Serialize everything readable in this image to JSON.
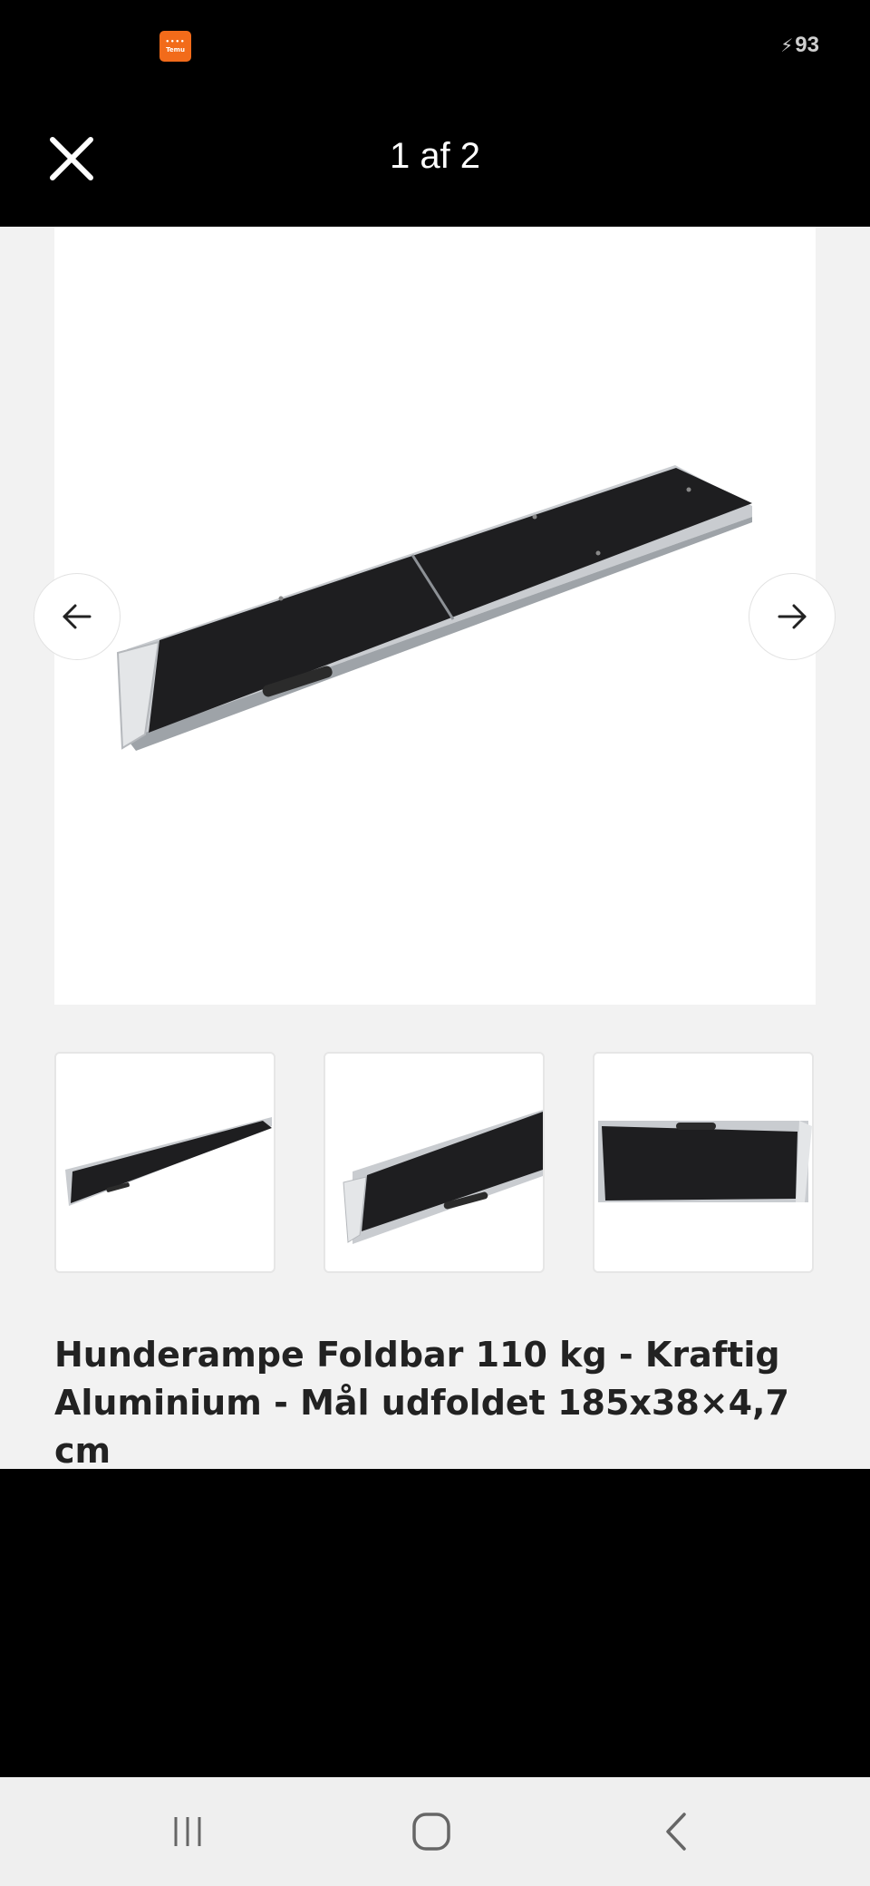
{
  "status_bar": {
    "app_icon_text": "Temu",
    "battery": "93"
  },
  "header": {
    "page_counter": "1 af 2"
  },
  "gallery": {
    "main_image": "folding-dog-ramp-photo",
    "thumbnails": [
      "ramp-unfolded-thumbnail",
      "ramp-closeup-thumbnail",
      "ramp-folded-thumbnail"
    ]
  },
  "product": {
    "title": "Hunderampe Foldbar 110 kg - Kraftig Aluminium - Mål udfoldet 185x38×4,7 cm"
  },
  "icons": {
    "close": "close-icon",
    "prev": "arrow-left-icon",
    "next": "arrow-right-icon",
    "recents": "recents-icon",
    "home": "home-icon",
    "back": "back-icon"
  },
  "colors": {
    "brand": "#f26b1a",
    "ramp_surface": "#1e1e20",
    "ramp_frame": "#c9ccd0"
  }
}
